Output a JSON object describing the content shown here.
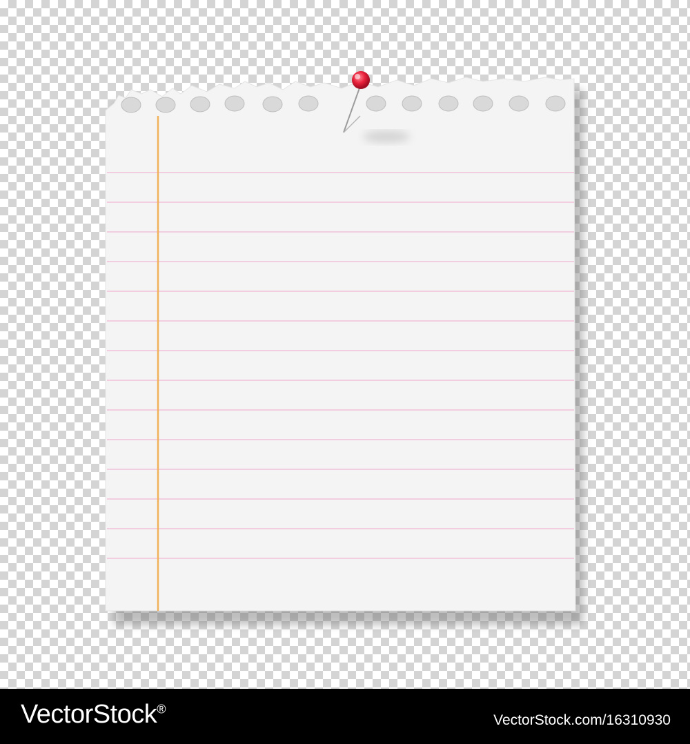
{
  "scene": {
    "subject": "torn-notebook-paper-note",
    "background": "transparency-checkerboard",
    "paper_color": "#f4f4f4",
    "rule_line_color": "#f2cde0",
    "margin_line_color": "#f0b15a",
    "pin_color": "#e8203a",
    "ruled_line_count": 14,
    "punch_hole_count": 12
  },
  "footer": {
    "brand_name": "VectorStock",
    "brand_mark": "®",
    "image_id": "VectorStock.com/16310930",
    "background_color": "#000000"
  }
}
